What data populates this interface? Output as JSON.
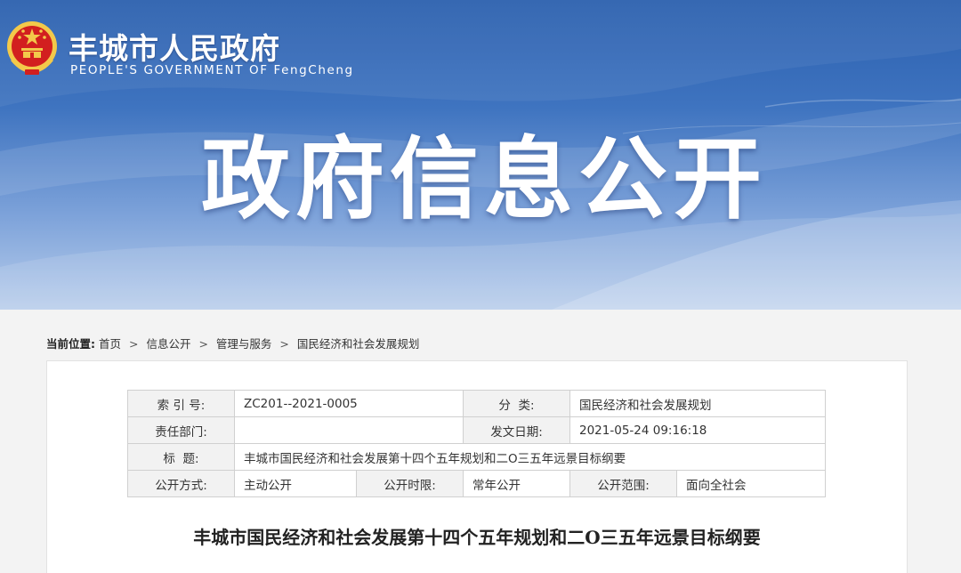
{
  "header": {
    "site_name": "丰城市人民政府",
    "site_name_en": "PEOPLE'S GOVERNMENT OF FengCheng",
    "banner_title": "政府信息公开",
    "emblem_icon": "national-emblem-icon"
  },
  "breadcrumb": {
    "prefix": "当前位置:",
    "separator": ">",
    "items": [
      "首页",
      "信息公开",
      "管理与服务",
      "国民经济和社会发展规划"
    ]
  },
  "meta_table": {
    "index_label": "索 引 号:",
    "index_value": "ZC201--2021-0005",
    "category_label": "分  类:",
    "category_value": "国民经济和社会发展规划",
    "department_label": "责任部门:",
    "department_value": "",
    "date_label": "发文日期:",
    "date_value": "2021-05-24 09:16:18",
    "title_label": "标  题:",
    "title_value": "丰城市国民经济和社会发展第十四个五年规划和二O三五年远景目标纲要",
    "method_label": "公开方式:",
    "method_value": "主动公开",
    "period_label": "公开时限:",
    "period_value": "常年公开",
    "scope_label": "公开范围:",
    "scope_value": "面向全社会"
  },
  "document": {
    "title": "丰城市国民经济和社会发展第十四个五年规划和二O三五年远景目标纲要"
  },
  "colors": {
    "banner_blue": "#2a5fae",
    "emblem_red": "#d21f1f",
    "emblem_gold": "#f3c94a"
  }
}
